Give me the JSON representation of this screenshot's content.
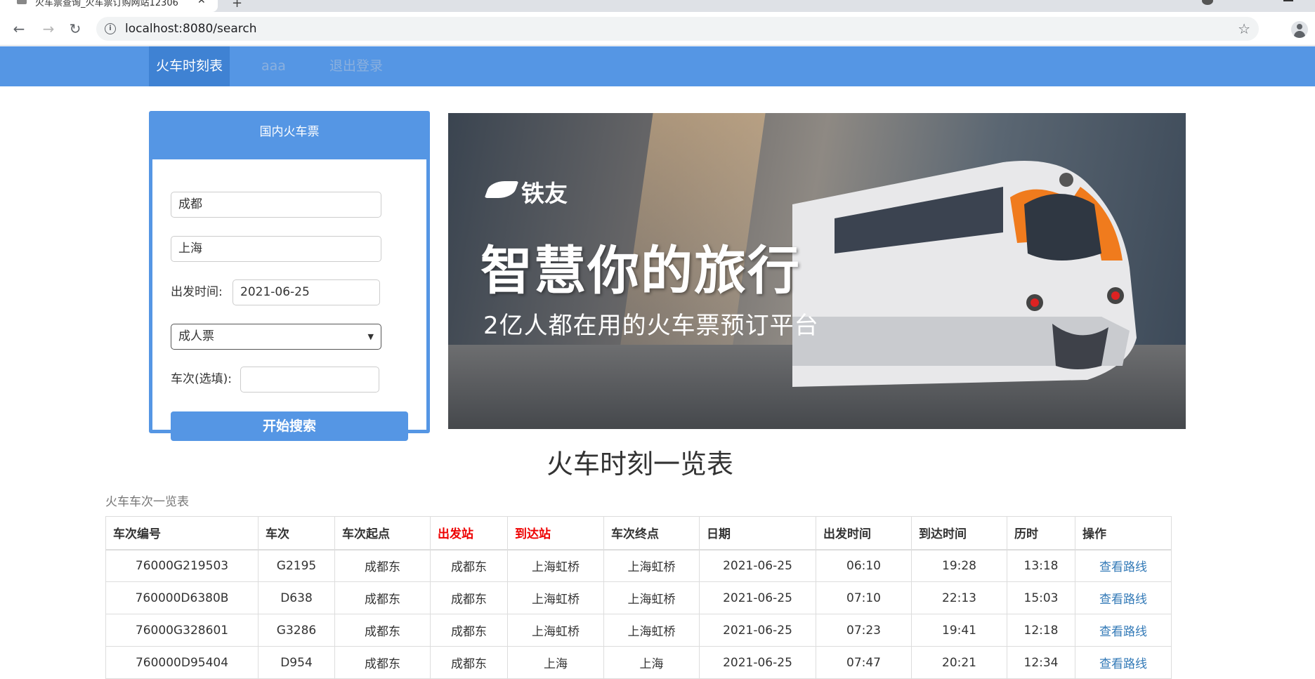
{
  "browser": {
    "tab_title": "火车票查询_火车票订购网站12306",
    "url": "localhost:8080/search"
  },
  "nav": {
    "items": [
      {
        "label": "火车时刻表"
      },
      {
        "label": "aaa"
      },
      {
        "label": "退出登录"
      }
    ]
  },
  "search_panel": {
    "title": "国内火车票",
    "from_value": "成都",
    "to_value": "上海",
    "date_label": "出发时间:",
    "date_value": "2021-06-25",
    "ticket_type": "成人票",
    "train_label": "车次(选填):",
    "train_value": "",
    "search_button": "开始搜索"
  },
  "banner": {
    "brand": "铁友",
    "slogan": "智慧你的旅行",
    "subslogan": "2亿人都在用的火车票预订平台"
  },
  "timetable": {
    "title": "火车时刻一览表",
    "caption": "火车车次一览表",
    "headers": [
      "车次编号",
      "车次",
      "车次起点",
      "出发站",
      "到达站",
      "车次终点",
      "日期",
      "出发时间",
      "到达时间",
      "历时",
      "操作"
    ],
    "rows": [
      [
        "76000G219503",
        "G2195",
        "成都东",
        "成都东",
        "上海虹桥",
        "上海虹桥",
        "2021-06-25",
        "06:10",
        "19:28",
        "13:18",
        "查看路线"
      ],
      [
        "760000D6380B",
        "D638",
        "成都东",
        "成都东",
        "上海虹桥",
        "上海虹桥",
        "2021-06-25",
        "07:10",
        "22:13",
        "15:03",
        "查看路线"
      ],
      [
        "76000G328601",
        "G3286",
        "成都东",
        "成都东",
        "上海虹桥",
        "上海虹桥",
        "2021-06-25",
        "07:23",
        "19:41",
        "12:18",
        "查看路线"
      ],
      [
        "760000D95404",
        "D954",
        "成都东",
        "成都东",
        "上海",
        "上海",
        "2021-06-25",
        "07:47",
        "20:21",
        "12:34",
        "查看路线"
      ]
    ]
  },
  "colors": {
    "nav_bg": "#5596e4",
    "nav_active": "#3f82d3",
    "link": "#337ab7",
    "highlight_header": "#e00000"
  }
}
